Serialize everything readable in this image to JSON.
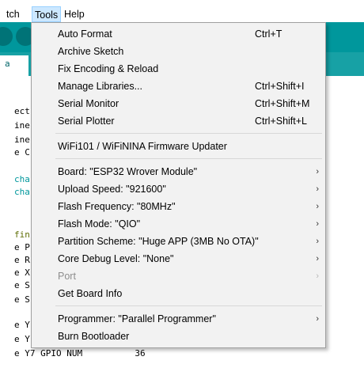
{
  "menubar": {
    "sketch_label": "tch",
    "tools_label": "Tools",
    "help_label": "Help"
  },
  "background": {
    "tab_fragment": "a",
    "code_fragments": [
      "ect",
      "ine",
      "ine",
      "e C",
      "cha",
      "cha",
      "fin",
      "e P",
      "e R",
      "e X",
      "e S",
      "e S",
      "e Y",
      "e Y",
      "e Y7 GPIO NUM          36"
    ]
  },
  "tools_menu": {
    "items": [
      {
        "label": "Auto Format",
        "shortcut": "Ctrl+T"
      },
      {
        "label": "Archive Sketch",
        "shortcut": ""
      },
      {
        "label": "Fix Encoding & Reload",
        "shortcut": ""
      },
      {
        "label": "Manage Libraries...",
        "shortcut": "Ctrl+Shift+I"
      },
      {
        "label": "Serial Monitor",
        "shortcut": "Ctrl+Shift+M"
      },
      {
        "label": "Serial Plotter",
        "shortcut": "Ctrl+Shift+L"
      },
      {
        "label": "WiFi101 / WiFiNINA Firmware Updater",
        "shortcut": ""
      },
      {
        "label": "Board: \"ESP32 Wrover Module\"",
        "submenu": "›"
      },
      {
        "label": "Upload Speed: \"921600\"",
        "submenu": "›"
      },
      {
        "label": "Flash Frequency: \"80MHz\"",
        "submenu": "›"
      },
      {
        "label": "Flash Mode: \"QIO\"",
        "submenu": "›"
      },
      {
        "label": "Partition Scheme: \"Huge APP (3MB No OTA)\"",
        "submenu": "›"
      },
      {
        "label": "Core Debug Level: \"None\"",
        "submenu": "›"
      },
      {
        "label": "Port",
        "submenu": "›",
        "disabled": true
      },
      {
        "label": "Get Board Info",
        "shortcut": ""
      },
      {
        "label": "Programmer: \"Parallel Programmer\"",
        "submenu": "›"
      },
      {
        "label": "Burn Bootloader",
        "shortcut": ""
      }
    ]
  },
  "colors": {
    "ide_toolbar": "#00979c",
    "menu_bg": "#f2f2f2",
    "highlight": "#cce8ff",
    "disabled_text": "#8d8d8d"
  }
}
